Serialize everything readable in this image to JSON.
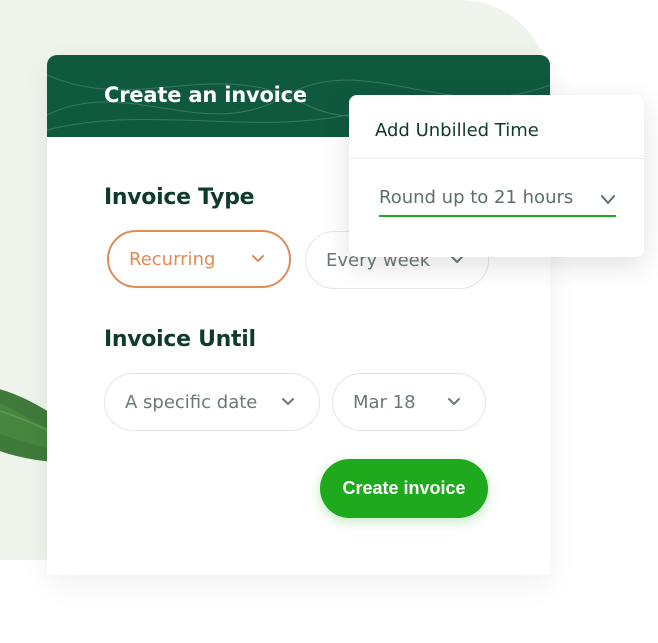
{
  "card": {
    "title": "Create an invoice"
  },
  "invoice_type": {
    "label": "Invoice Type",
    "type_select": {
      "value": "Recurring"
    },
    "frequency_select": {
      "value": "Every week"
    }
  },
  "invoice_until": {
    "label": "Invoice Until",
    "until_select": {
      "value": "A specific date"
    },
    "date_select": {
      "value": "Mar 18"
    }
  },
  "actions": {
    "create_label": "Create invoice"
  },
  "popover": {
    "title": "Add Unbilled Time",
    "select": {
      "value": "Round up to 21 hours"
    }
  },
  "colors": {
    "header": "#0f5a3f",
    "accent_green": "#1faa1d",
    "active_orange": "#e08a56",
    "heading_text": "#0f3b2c"
  }
}
